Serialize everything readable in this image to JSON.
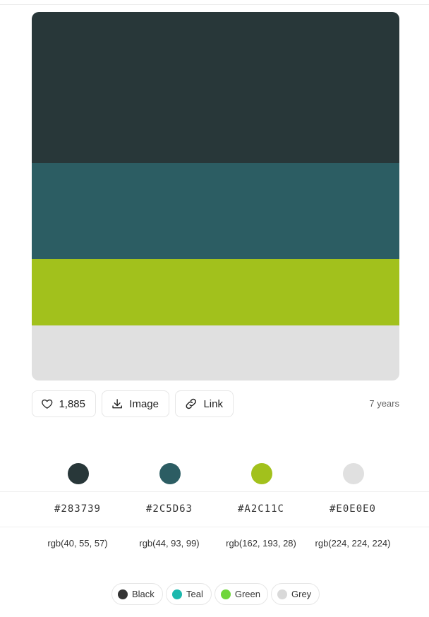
{
  "palette": {
    "colors": [
      {
        "hex": "#283739",
        "rgb": "rgb(40, 55, 57)"
      },
      {
        "hex": "#2C5D63",
        "rgb": "rgb(44, 93, 99)"
      },
      {
        "hex": "#A2C11C",
        "rgb": "rgb(162, 193, 28)"
      },
      {
        "hex": "#E0E0E0",
        "rgb": "rgb(224, 224, 224)"
      }
    ]
  },
  "actions": {
    "likes": "1,885",
    "image_label": "Image",
    "link_label": "Link",
    "age": "7 years",
    "icons": {
      "like": "heart-icon",
      "image": "download-icon",
      "link": "link-icon"
    }
  },
  "tags": [
    {
      "label": "Black",
      "color": "#333333"
    },
    {
      "label": "Teal",
      "color": "#1cb8ad"
    },
    {
      "label": "Green",
      "color": "#6fd63a"
    },
    {
      "label": "Grey",
      "color": "#d9d9d9"
    }
  ]
}
